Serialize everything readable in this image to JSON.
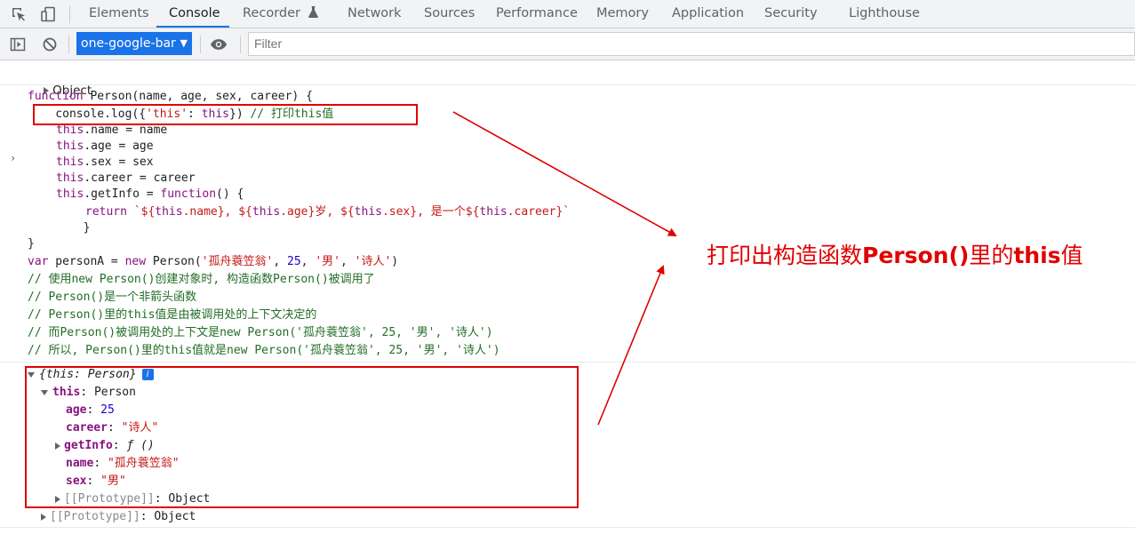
{
  "tabs": [
    {
      "label": "Elements"
    },
    {
      "label": "Console"
    },
    {
      "label": "Recorder"
    },
    {
      "label": "Network"
    },
    {
      "label": "Sources"
    },
    {
      "label": "Performance"
    },
    {
      "label": "Memory"
    },
    {
      "label": "Application"
    },
    {
      "label": "Security"
    },
    {
      "label": "Lighthouse"
    }
  ],
  "active_tab": "Console",
  "toolbar": {
    "context": "one-google-bar",
    "filter_placeholder": "Filter"
  },
  "colors": {
    "accent": "#1a73e8",
    "annotation": "#e00000",
    "keyword": "#881280",
    "string": "#c41a16",
    "comment": "#236e25"
  },
  "console": {
    "first_object": "Object",
    "code": {
      "l1": {
        "kw": "function",
        "rest": " Person(name, age, sex, career) {"
      },
      "l2": {
        "a": "    console.log({",
        "s": "'this'",
        "b": ": ",
        "k": "this",
        "c": "}) ",
        "cm": "// 打印this值"
      },
      "l3": {
        "k": "this",
        "r": ".name = name"
      },
      "l4": {
        "k": "this",
        "r": ".age = age"
      },
      "l5": {
        "k": "this",
        "r": ".sex = sex"
      },
      "l6": {
        "k": "this",
        "r": ".career = career"
      },
      "l7": {
        "k": "this",
        "r": ".getInfo = ",
        "k2": "function",
        "r2": "() {"
      },
      "l8": {
        "kw": "return",
        "t1": "`${",
        "k1": "this",
        "t2": ".name}, ${",
        "k2": "this",
        "t3": ".age}岁, ${",
        "k3": "this",
        "t4": ".sex}, 是一个${",
        "k4": "this",
        "t5": ".career}`"
      },
      "l9": "        }",
      "l10": "}",
      "l11": {
        "kw": "var",
        "a": " personA = ",
        "kw2": "new",
        "b": " Person(",
        "s1": "'孤舟蓑笠翁'",
        "c": ", ",
        "n": "25",
        "d": ", ",
        "s2": "'男'",
        "e": ", ",
        "s3": "'诗人'",
        "f": ")"
      },
      "c1": "// 使用new Person()创建对象时, 构造函数Person()被调用了",
      "c2": "// Person()是一个非箭头函数",
      "c3": "// Person()里的this值是由被调用处的上下文决定的",
      "c4": "// 而Person()被调用处的上下文是new Person('孤舟蓑笠翁', 25, '男', '诗人')",
      "c5": "// 所以, Person()里的this值就是new Person('孤舟蓑笠翁', 25, '男', '诗人')"
    },
    "result": {
      "header": "{this: Person}",
      "info_badge": "i",
      "this_key": "this",
      "this_val": "Person",
      "props": [
        {
          "key": "age",
          "value": "25"
        },
        {
          "key": "career",
          "value": "\"诗人\""
        },
        {
          "key": "getInfo",
          "value": "ƒ ()"
        },
        {
          "key": "name",
          "value": "\"孤舟蓑笠翁\""
        },
        {
          "key": "sex",
          "value": "\"男\""
        }
      ],
      "proto_inner": "[[Prototype]]",
      "proto_inner_val": "Object",
      "proto_outer": "[[Prototype]]",
      "proto_outer_val": "Object"
    }
  },
  "annotation": {
    "prefix": "打印出构造函数",
    "bold1": "Person()",
    "mid": "里的",
    "bold2": "this",
    "suffix": "值"
  }
}
